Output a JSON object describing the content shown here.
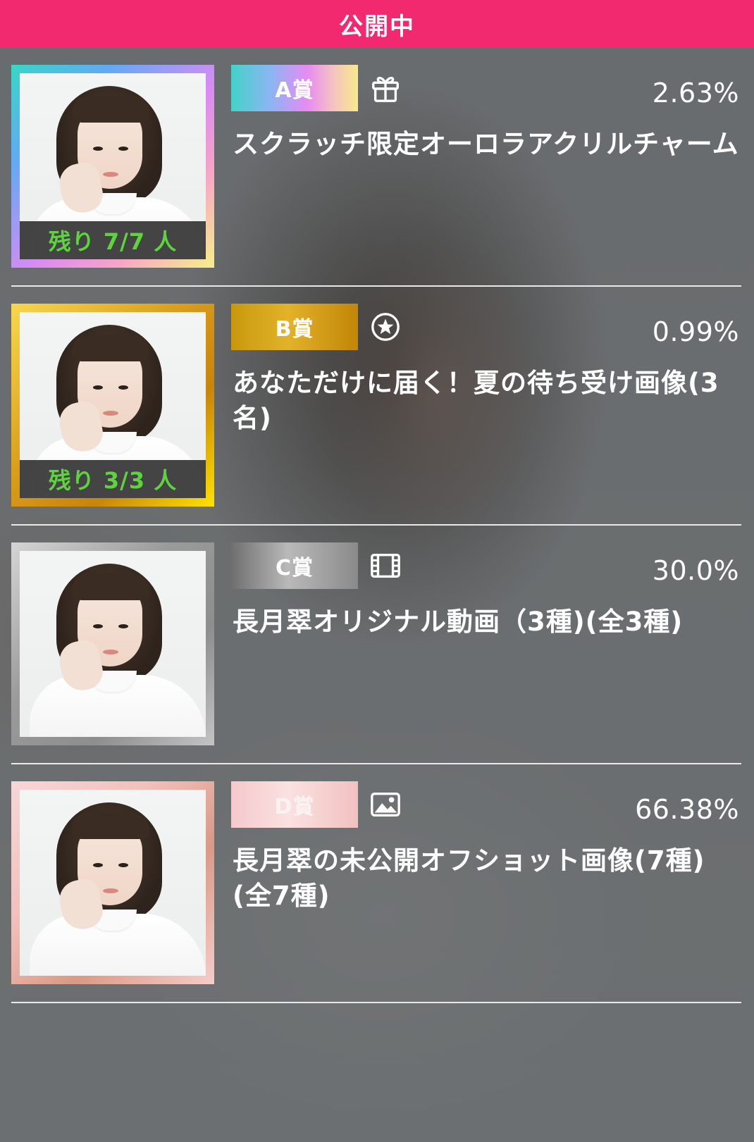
{
  "header": {
    "title": "公開中"
  },
  "colors": {
    "header_bg": "#f3296f",
    "remaining_text": "#5fd33f",
    "divider": "#e9e9e9"
  },
  "prizes": [
    {
      "rank": "A賞",
      "icon": "gift-icon",
      "rate": "2.63%",
      "name": "スクラッチ限定オーロラアクリルチャーム",
      "remaining": "残り 7/7 人"
    },
    {
      "rank": "B賞",
      "icon": "star-circle-icon",
      "rate": "0.99%",
      "name": "あなただけに届く！夏の待ち受け画像(3名)",
      "remaining": "残り 3/3 人"
    },
    {
      "rank": "C賞",
      "icon": "film-icon",
      "rate": "30.0%",
      "name": "長月翠オリジナル動画（3種)(全3種)"
    },
    {
      "rank": "D賞",
      "icon": "image-icon",
      "rate": "66.38%",
      "name": "長月翠の未公開オフショット画像(7種)(全7種)"
    }
  ]
}
